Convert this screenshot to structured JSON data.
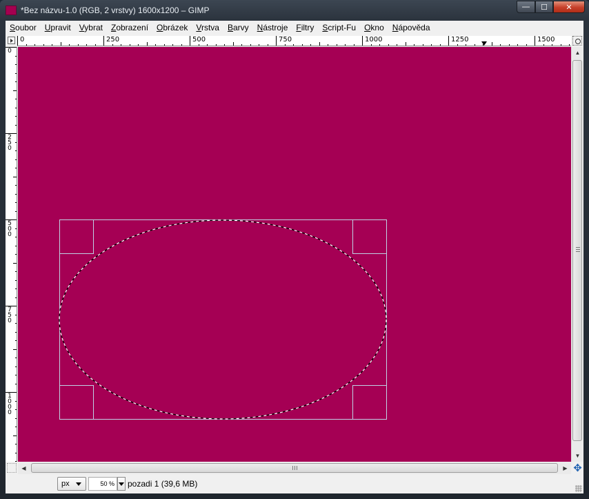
{
  "window": {
    "title": "*Bez názvu-1.0 (RGB, 2 vrstvy) 1600x1200 – GIMP",
    "app_icon_color": "#a50050",
    "controls": {
      "minimize": "—",
      "maximize": "☐",
      "close": "✕"
    }
  },
  "menubar": {
    "items": [
      {
        "first": "S",
        "rest": "oubor"
      },
      {
        "first": "U",
        "rest": "pravit"
      },
      {
        "first": "V",
        "rest": "ybrat"
      },
      {
        "first": "Z",
        "rest": "obrazení"
      },
      {
        "first": "O",
        "rest": "brázek"
      },
      {
        "first": "V",
        "rest": "rstva"
      },
      {
        "first": "B",
        "rest": "arvy"
      },
      {
        "first": "N",
        "rest": "ástroje"
      },
      {
        "first": "F",
        "rest": "iltry"
      },
      {
        "first": "S",
        "rest": "cript-Fu"
      },
      {
        "first": "O",
        "rest": "kno"
      },
      {
        "first": "N",
        "rest": "ápověda"
      }
    ]
  },
  "rulers": {
    "horizontal_labels": [
      "0",
      "250",
      "500",
      "750",
      "1000",
      "1250",
      "1500"
    ],
    "vertical_labels": [
      "0",
      "250",
      "500",
      "750",
      "1000"
    ]
  },
  "canvas": {
    "background_color": "#a50054",
    "selection": "ellipse"
  },
  "statusbar": {
    "unit": "px",
    "zoom": "50 %",
    "layer_info": "pozadi 1 (39,6 MB)"
  },
  "icons": {
    "quick_mask": "quick-mask-icon",
    "navigate": "navigate-icon",
    "zoom_fit": "zoom-fit-icon",
    "menu_arrow": "menu-arrow-icon"
  }
}
